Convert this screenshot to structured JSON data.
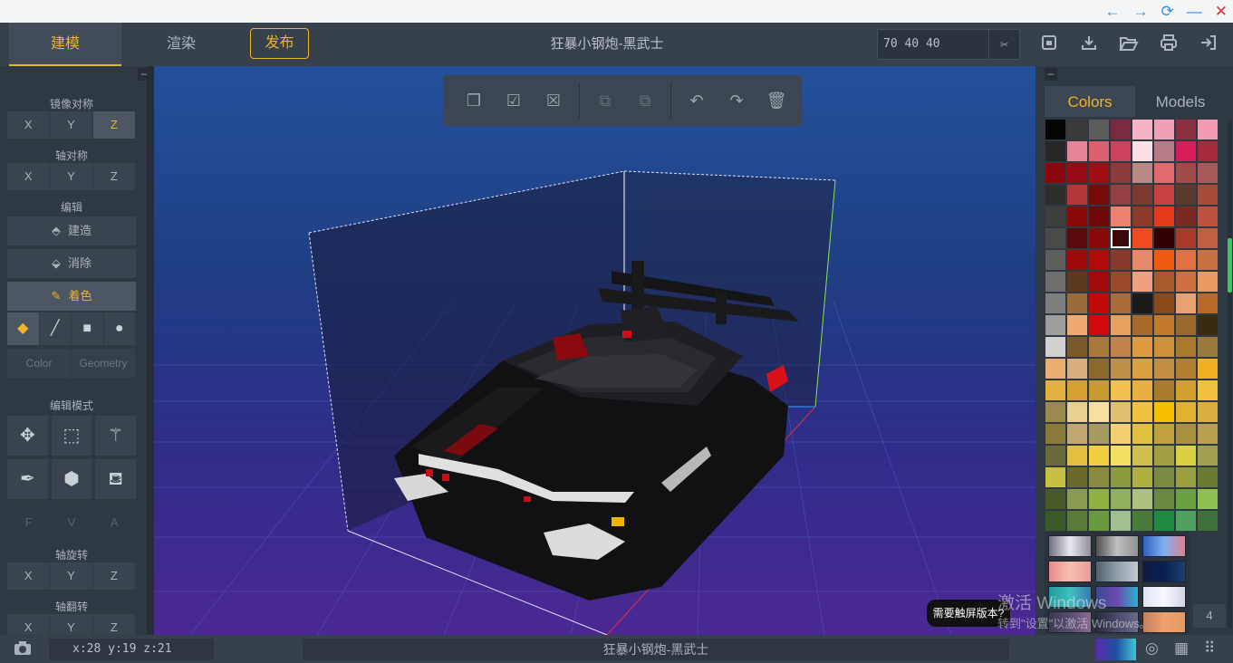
{
  "window": {
    "back_icon": "←",
    "forward_icon": "→",
    "refresh_icon": "⟳",
    "minimize_icon": "—",
    "close_icon": "✕"
  },
  "header": {
    "tabs": [
      {
        "label": "建模"
      },
      {
        "label": "渲染"
      }
    ],
    "publish_label": "发布",
    "title": "狂暴小钢炮-黑武士",
    "dimensions_value": "70 40 40",
    "icons": [
      "resize-icon",
      "save-icon",
      "download-icon",
      "folder-open-icon",
      "print-icon",
      "exit-icon"
    ]
  },
  "left": {
    "mirror_title": "镜像对称",
    "mirror_axes": [
      "X",
      "Y",
      "Z"
    ],
    "axis_sym_title": "轴对称",
    "axis_sym_axes": [
      "X",
      "Y",
      "Z"
    ],
    "edit_title": "编辑",
    "build_label": "建造",
    "erase_label": "消除",
    "paint_label": "着色",
    "color_label": "Color",
    "geometry_label": "Geometry",
    "edit_mode_title": "编辑模式",
    "fva": [
      "F",
      "V",
      "A"
    ],
    "rotate_title": "轴旋转",
    "rotate_axes": [
      "X",
      "Y",
      "Z"
    ],
    "flip_title": "轴翻转",
    "flip_axes": [
      "X",
      "Y",
      "Z"
    ]
  },
  "right": {
    "tabs": [
      "Colors",
      "Models"
    ],
    "page_number": "4",
    "palette": [
      "#050505",
      "#3a3a3a",
      "#5c5c5c",
      "#7a2a3e",
      "#f5b3c6",
      "#f0a0b6",
      "#8a3040",
      "#f29bb2",
      "#262626",
      "#e8849a",
      "#d9606e",
      "#cc4060",
      "#fbe0e6",
      "#b87a86",
      "#d81b5a",
      "#a52a3a",
      "#8a0810",
      "#990b14",
      "#9e0e12",
      "#8c3a3a",
      "#b88a86",
      "#e06a70",
      "#a04a4a",
      "#a85a5a",
      "#2e2e2e",
      "#b03838",
      "#7a0a0a",
      "#944040",
      "#7a3a30",
      "#c94040",
      "#5a3a2e",
      "#a84a3a",
      "#3e3e3e",
      "#8a0a0a",
      "#6e0808",
      "#f08070",
      "#8e3a2a",
      "#e23a1a",
      "#7a2a22",
      "#c05040",
      "#4a4a4a",
      "#5a0a0a",
      "#8a0a0a",
      "#3a0808",
      "#f04a20",
      "#300000",
      "#aa3a2a",
      "#c06040",
      "#5e5e5e",
      "#9e0a0a",
      "#b00a0a",
      "#8a3a2a",
      "#e88a6a",
      "#f05a10",
      "#e07040",
      "#c87040",
      "#6e6e6e",
      "#5a3a1e",
      "#a00a0a",
      "#9a4a2a",
      "#f0a080",
      "#a85a2a",
      "#d07040",
      "#e89a60",
      "#7e7e7e",
      "#9a6a3a",
      "#c00a0a",
      "#aa6a3a",
      "#1a1a1a",
      "#8a4a1a",
      "#e8a070",
      "#b86a2a",
      "#9e9e9e",
      "#f0aa70",
      "#d00a0a",
      "#e8a060",
      "#a86a2a",
      "#c07a2a",
      "#9a6a2a",
      "#3a2a10",
      "#d0d0d0",
      "#7a5a2a",
      "#a87a3a",
      "#c0844a",
      "#e09a40",
      "#d0903a",
      "#a87a2a",
      "#9a7a3a",
      "#e8b070",
      "#d8b080",
      "#8a6a2a",
      "#c0904a",
      "#d8a040",
      "#c09040",
      "#b08030",
      "#f0b020",
      "#e0b040",
      "#d8a030",
      "#c89a30",
      "#f0c050",
      "#e8b040",
      "#a87a2a",
      "#d0a030",
      "#f0c040",
      "#9a8a50",
      "#e8d090",
      "#f5e0a0",
      "#e0c070",
      "#f0c040",
      "#f5c000",
      "#e0b030",
      "#d8b040",
      "#8a7a3a",
      "#c0a870",
      "#a89a60",
      "#f0d070",
      "#e0c040",
      "#c0a040",
      "#a89040",
      "#b8a050",
      "#6a6a3a",
      "#e0c040",
      "#f0d040",
      "#f5e060",
      "#d0c050",
      "#a0a040",
      "#d8d040",
      "#a0a050",
      "#c8c040",
      "#6a6a2a",
      "#8a8a40",
      "#8a9a40",
      "#b0b040",
      "#7a8a40",
      "#9aa040",
      "#6a7a30",
      "#4a5a2a",
      "#8a9a50",
      "#90b040",
      "#90b060",
      "#b0c080",
      "#6a8a40",
      "#6aa040",
      "#90c050",
      "#3a5a2a",
      "#5a7a3a",
      "#6a9a40",
      "#a0c090",
      "#4a7a3a",
      "#208a40",
      "#50a060",
      "#40703a"
    ],
    "gradients": [
      "linear-gradient(90deg,#707080,#e8e8f0,#909098)",
      "linear-gradient(90deg,#505050,#c0c0c0,#909090)",
      "linear-gradient(90deg,#3060c0,#80b0f0,#e08090)",
      "linear-gradient(90deg,#e88a8a,#f8c0b0,#e89a9a)",
      "linear-gradient(90deg,#506070,#90a0a8,#c0c8d0)",
      "linear-gradient(90deg,#101a40,#0a2050,#1a4070)",
      "linear-gradient(90deg,#209a9a,#40c0c0,#3a7ab0)",
      "linear-gradient(90deg,#3a4a90,#6a4ab0,#2ab0d0)",
      "linear-gradient(90deg,#e0e4f0,#f8f8ff,#d0d4e0)",
      "linear-gradient(90deg,#3a3a50,#5a4a70,#8a6a90)",
      "linear-gradient(90deg,#2a2a40,#4a4a6a,#6a6a90)",
      "linear-gradient(90deg,#c08060,#f0a070,#e09a60)"
    ]
  },
  "toolbar": {
    "icons": [
      "copy-icon",
      "select-all-icon",
      "deselect-icon",
      "layer-down-icon",
      "layer-up-icon",
      "undo-icon",
      "redo-icon",
      "delete-icon"
    ]
  },
  "status": {
    "coords": "x:28 y:19 z:21",
    "title": "狂暴小钢炮-黑武士"
  },
  "overlay": {
    "toast": "需要触屏版本?",
    "watermark_line1": "激活 Windows",
    "watermark_line2": "转到\"设置\"以激活 Windows。"
  }
}
